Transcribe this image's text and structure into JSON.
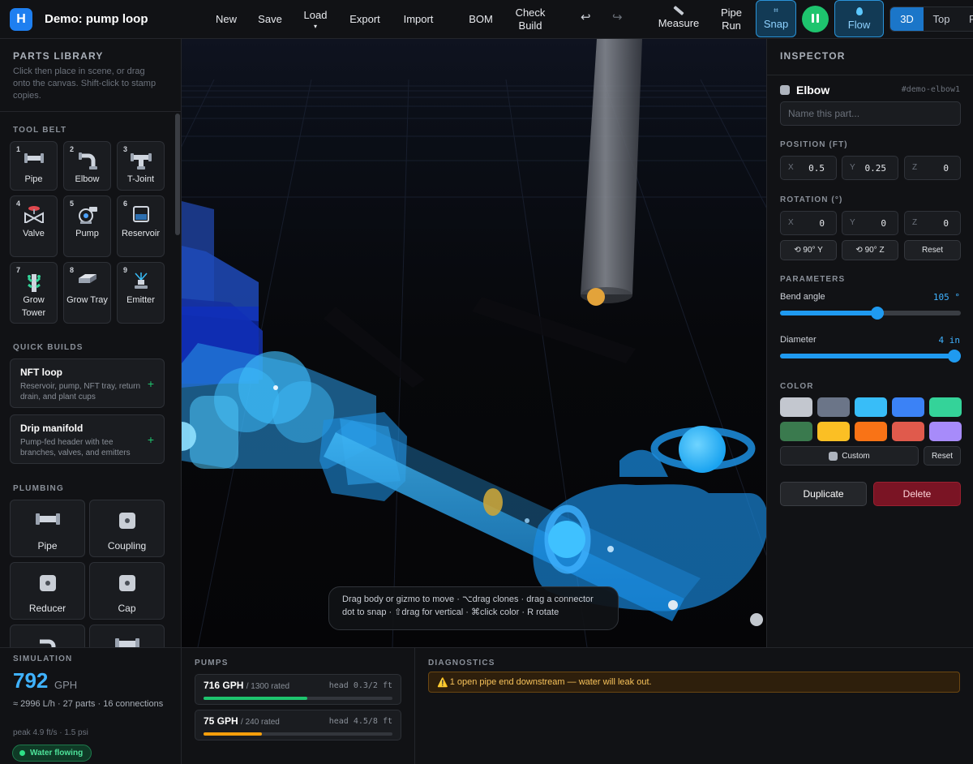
{
  "app": {
    "logo_letter": "H",
    "title": "Demo: pump loop"
  },
  "toolbar": {
    "new": "New",
    "save": "Save",
    "load": "Load",
    "load_caret": "▾",
    "export": "Export",
    "import": "Import",
    "bom": "BOM",
    "check_build_1": "Check",
    "check_build_2": "Build",
    "undo_icon": "↩",
    "redo_icon": "↪",
    "measure": "Measure",
    "pipe_run_1": "Pipe",
    "pipe_run_2": "Run",
    "snap_icon": "⌗",
    "snap": "Snap",
    "flow": "Flow",
    "views": [
      "3D",
      "Top",
      "F"
    ],
    "active_view": "3D"
  },
  "sidebar": {
    "title": "PARTS LIBRARY",
    "description": "Click then place in scene, or drag onto the canvas. Shift-click to stamp copies.",
    "tool_belt_label": "TOOL BELT",
    "tool_belt": [
      {
        "key": "1",
        "label": "Pipe",
        "icon": "pipe-icon"
      },
      {
        "key": "2",
        "label": "Elbow",
        "icon": "elbow-icon"
      },
      {
        "key": "3",
        "label": "T-Joint",
        "icon": "tee-icon"
      },
      {
        "key": "4",
        "label": "Valve",
        "icon": "valve-icon"
      },
      {
        "key": "5",
        "label": "Pump",
        "icon": "pump-icon"
      },
      {
        "key": "6",
        "label": "Reservoir",
        "icon": "reservoir-icon"
      },
      {
        "key": "7",
        "label": "Grow Tower",
        "icon": "grow-tower-icon"
      },
      {
        "key": "8",
        "label": "Grow Tray",
        "icon": "grow-tray-icon"
      },
      {
        "key": "9",
        "label": "Emitter",
        "icon": "emitter-icon"
      }
    ],
    "quick_builds_label": "QUICK BUILDS",
    "quick_builds": [
      {
        "title": "NFT loop",
        "desc": "Reservoir, pump, NFT tray, return drain, and plant cups",
        "plus": "+"
      },
      {
        "title": "Drip manifold",
        "desc": "Pump-fed header with tee branches, valves, and emitters",
        "plus": "+"
      }
    ],
    "plumbing_label": "PLUMBING",
    "plumbing": [
      {
        "label": "Pipe",
        "icon": "pipe-icon"
      },
      {
        "label": "Coupling",
        "icon": "coupling-icon"
      },
      {
        "label": "Reducer",
        "icon": "reducer-icon"
      },
      {
        "label": "Cap",
        "icon": "cap-icon"
      }
    ]
  },
  "viewport": {
    "hint": "Drag body or gizmo to move · ⌥drag clones · drag a connector dot to snap · ⇧drag for vertical · ⌘click color · R rotate"
  },
  "inspector": {
    "title": "INSPECTOR",
    "part_name": "Elbow",
    "part_id": "#demo-elbow1",
    "name_placeholder": "Name this part...",
    "position_label": "POSITION (FT)",
    "position": {
      "x": "0.5",
      "y": "0.25",
      "z": "0"
    },
    "rotation_label": "ROTATION (°)",
    "rotation": {
      "x": "0",
      "y": "0",
      "z": "0"
    },
    "axis_labels": {
      "x": "X",
      "y": "Y",
      "z": "Z"
    },
    "rot_buttons": {
      "y90": "⟲ 90° Y",
      "z90": "⟲ 90° Z",
      "reset": "Reset"
    },
    "parameters_label": "PARAMETERS",
    "bend_angle": {
      "label": "Bend angle",
      "value": "105 °",
      "fraction": 0.54
    },
    "diameter": {
      "label": "Diameter",
      "value": "4 in",
      "fraction": 1.0
    },
    "color_label": "COLOR",
    "swatches": [
      "#c3c7cf",
      "#6b7588",
      "#38bdf8",
      "#3b82f6",
      "#34d399",
      "#3a7a4e",
      "#fbbf24",
      "#f97316",
      "#e05a4c",
      "#a78bfa"
    ],
    "custom": "Custom",
    "color_reset": "Reset",
    "duplicate": "Duplicate",
    "delete": "Delete"
  },
  "simulation": {
    "title": "SIMULATION",
    "gph": "792",
    "gph_unit": "GPH",
    "summary": "≈ 2996 L/h · 27 parts · 16 connections",
    "peak": "peak 4.9 ft/s · 1.5 psi",
    "status": "Water flowing"
  },
  "pumps": {
    "title": "PUMPS",
    "items": [
      {
        "gph": "716 GPH",
        "rated": "/ 1300 rated",
        "head": "head 0.3/2 ft",
        "fill": 0.55,
        "color": "#1ec46e"
      },
      {
        "gph": "75 GPH",
        "rated": "/ 240 rated",
        "head": "head 4.5/8 ft",
        "fill": 0.31,
        "color": "#f59e0b"
      }
    ]
  },
  "diagnostics": {
    "title": "DIAGNOSTICS",
    "icon": "⚠️",
    "message": "1 open pipe end downstream — water will leak out."
  }
}
